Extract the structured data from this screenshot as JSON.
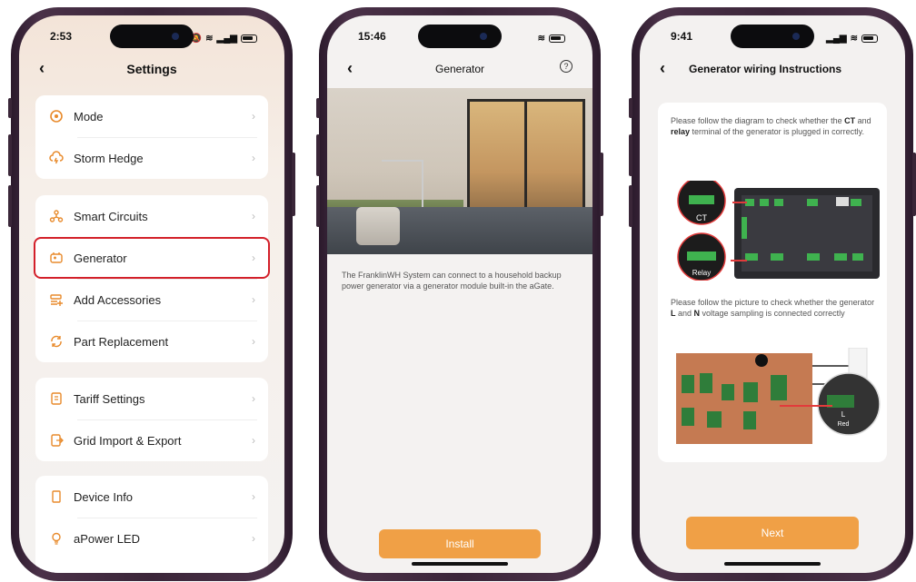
{
  "phone1": {
    "status": {
      "time": "2:53"
    },
    "title": "Settings",
    "groups": [
      {
        "items": [
          {
            "label": "Mode",
            "icon": "target-icon"
          },
          {
            "label": "Storm Hedge",
            "icon": "cloud-lightning-icon"
          }
        ]
      },
      {
        "items": [
          {
            "label": "Smart Circuits",
            "icon": "circuits-icon"
          },
          {
            "label": "Generator",
            "icon": "generator-icon"
          },
          {
            "label": "Add Accessories",
            "icon": "add-accessories-icon"
          },
          {
            "label": "Part Replacement",
            "icon": "replace-icon"
          }
        ]
      },
      {
        "items": [
          {
            "label": "Tariff Settings",
            "icon": "tariff-icon"
          },
          {
            "label": "Grid Import & Export",
            "icon": "grid-export-icon"
          }
        ]
      },
      {
        "items": [
          {
            "label": "Device Info",
            "icon": "device-icon"
          },
          {
            "label": "aPower LED",
            "icon": "bulb-icon"
          }
        ]
      }
    ],
    "highlighted_item": "Generator"
  },
  "phone2": {
    "status": {
      "time": "15:46"
    },
    "title": "Generator",
    "description": "The FranklinWH System can connect to a household backup power generator via a generator module built-in the aGate.",
    "install_label": "Install"
  },
  "phone3": {
    "status": {
      "time": "9:41"
    },
    "title": "Generator wiring Instructions",
    "instruction1_pre": "Please follow the diagram to check whether the ",
    "instruction1_ct": "CT",
    "instruction1_mid": " and ",
    "instruction1_relay": "relay",
    "instruction1_post": " terminal of the generator is plugged in correctly.",
    "ct_label": "CT",
    "relay_label": "Relay",
    "instruction2_pre": "Please follow the picture to check whether the generator ",
    "instruction2_l": "L",
    "instruction2_mid": " and ",
    "instruction2_n": "N",
    "instruction2_post": " voltage sampling is connected correctly",
    "diagram2_label_l": "L",
    "diagram2_label_red": "Red",
    "next_label": "Next"
  },
  "colors": {
    "accent": "#e88a2b",
    "button": "#f0a046",
    "highlight": "#d3202a"
  }
}
